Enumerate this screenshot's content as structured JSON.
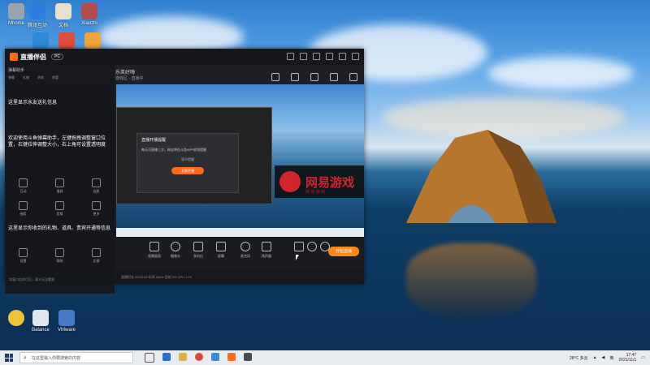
{
  "desktop": {
    "icons_top": [
      {
        "label": "Mhome",
        "color": "#9aa3ab"
      },
      {
        "label": "腾讯互动",
        "color": "#2e7de0"
      },
      {
        "label": "文档",
        "color": "#e8e1c8"
      },
      {
        "label": "Xiaozhi",
        "color": "#b44a4a"
      }
    ],
    "icons_row2": [
      {
        "label": "",
        "color": "#2a8ad8"
      },
      {
        "label": "",
        "color": "#e04c3a"
      },
      {
        "label": "",
        "color": "#f3a43a"
      }
    ],
    "icons_bottom": [
      {
        "label": "",
        "color": "#f0c23a"
      },
      {
        "label": "Balance",
        "color": "#dfe6ee"
      },
      {
        "label": "VMware",
        "color": "#4a78c8"
      }
    ]
  },
  "app": {
    "logo_text": "直播伴侣",
    "badge": "PC",
    "room_title": "乐英好嗨",
    "room_meta": "游戏区 · 直播中",
    "preview": {
      "dialog_title": "直播开播提醒",
      "dialog_text": "每天可直播三次，粉丝将在斗鱼APP收到提醒",
      "dialog_link": "暂不提醒",
      "dialog_button": "立即开播",
      "netease_text": "网易游戏",
      "netease_sub": "网 易 游 戏"
    },
    "controls": [
      {
        "label": "直播画面"
      },
      {
        "label": "摄像头"
      },
      {
        "label": "多机位"
      },
      {
        "label": "屏幕"
      },
      {
        "label": "麦克风"
      },
      {
        "label": "扬声器"
      }
    ],
    "start_button": "开始直播",
    "status_text": "直播时长 00:00:00    码率 0kb/s    丢帧 0%    CPU 17%",
    "timer": "00:00:00"
  },
  "sidebar": {
    "header": "弹幕助手",
    "tabs": [
      "弹幕",
      "礼物",
      "贵宾",
      "房管"
    ],
    "message1": "这里显示水友送礼信息",
    "message2": "欢迎使用斗鱼弹幕助手，左键拖拽调整窗口位置，右键拉伸调整大小，右上角可设置透明度",
    "message3": "这里显示弹幕、贵宾信息",
    "grid1": [
      "互动",
      "道具",
      "连麦"
    ],
    "grid2": [
      "抽奖",
      "竞猜",
      "更多"
    ],
    "message4": "这里显示你收到的礼物、道具、贵宾开通等信息",
    "grid3": [
      "设置",
      "帮助",
      "反馈"
    ],
    "note": "本窗口仅你可见，观众无法看到"
  },
  "taskbar": {
    "search_placeholder": "在这里输入你要搜索的内容",
    "weather": "28°C 多云",
    "lang": "英",
    "time": "17:47",
    "date": "2021/11/1"
  }
}
